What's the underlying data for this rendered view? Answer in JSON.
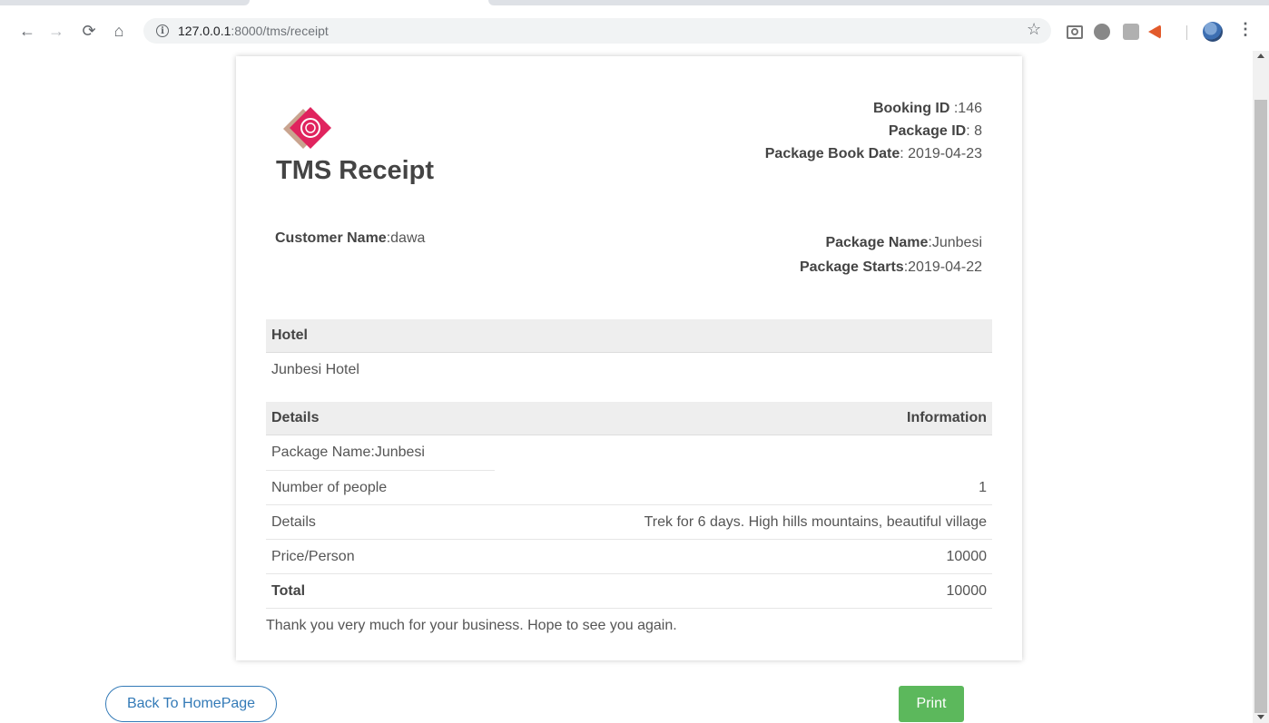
{
  "browser": {
    "url_host": "127.0.0.1",
    "url_path": ":8000/tms/receipt",
    "info_icon": "info-icon",
    "star_icon": "bookmark-star-icon"
  },
  "receipt": {
    "title": "TMS Receipt",
    "booking_id_label": "Booking ID",
    "booking_id_value": " :146",
    "package_id_label": "Package ID",
    "package_id_value": ": 8",
    "book_date_label": "Package Book Date",
    "book_date_value": ": 2019-04-23",
    "customer_label": "Customer Name",
    "customer_value": ":dawa",
    "package_name_label": "Package Name",
    "package_name_value": ":Junbesi",
    "package_starts_label": "Package Starts",
    "package_starts_value": ":2019-04-22",
    "hotel_header": "Hotel",
    "hotel_value": "Junbesi Hotel",
    "details_header": "Details",
    "information_header": "Information",
    "rows": [
      {
        "label": "Package Name:Junbesi",
        "value": ""
      },
      {
        "label": "Number of people",
        "value": "1"
      },
      {
        "label": "Details",
        "value": "Trek for 6 days. High hills mountains, beautiful village"
      },
      {
        "label": "Price/Person",
        "value": "10000"
      },
      {
        "label": "Total",
        "value": "10000"
      }
    ],
    "thanks": "Thank you very much for your business. Hope to see you again."
  },
  "actions": {
    "back_label": "Back To HomePage",
    "print_label": "Print"
  },
  "colors": {
    "print_button": "#5cb85c",
    "back_button": "#337ab7",
    "logo_pink": "#e0245e",
    "logo_tan": "#c9a48f"
  }
}
